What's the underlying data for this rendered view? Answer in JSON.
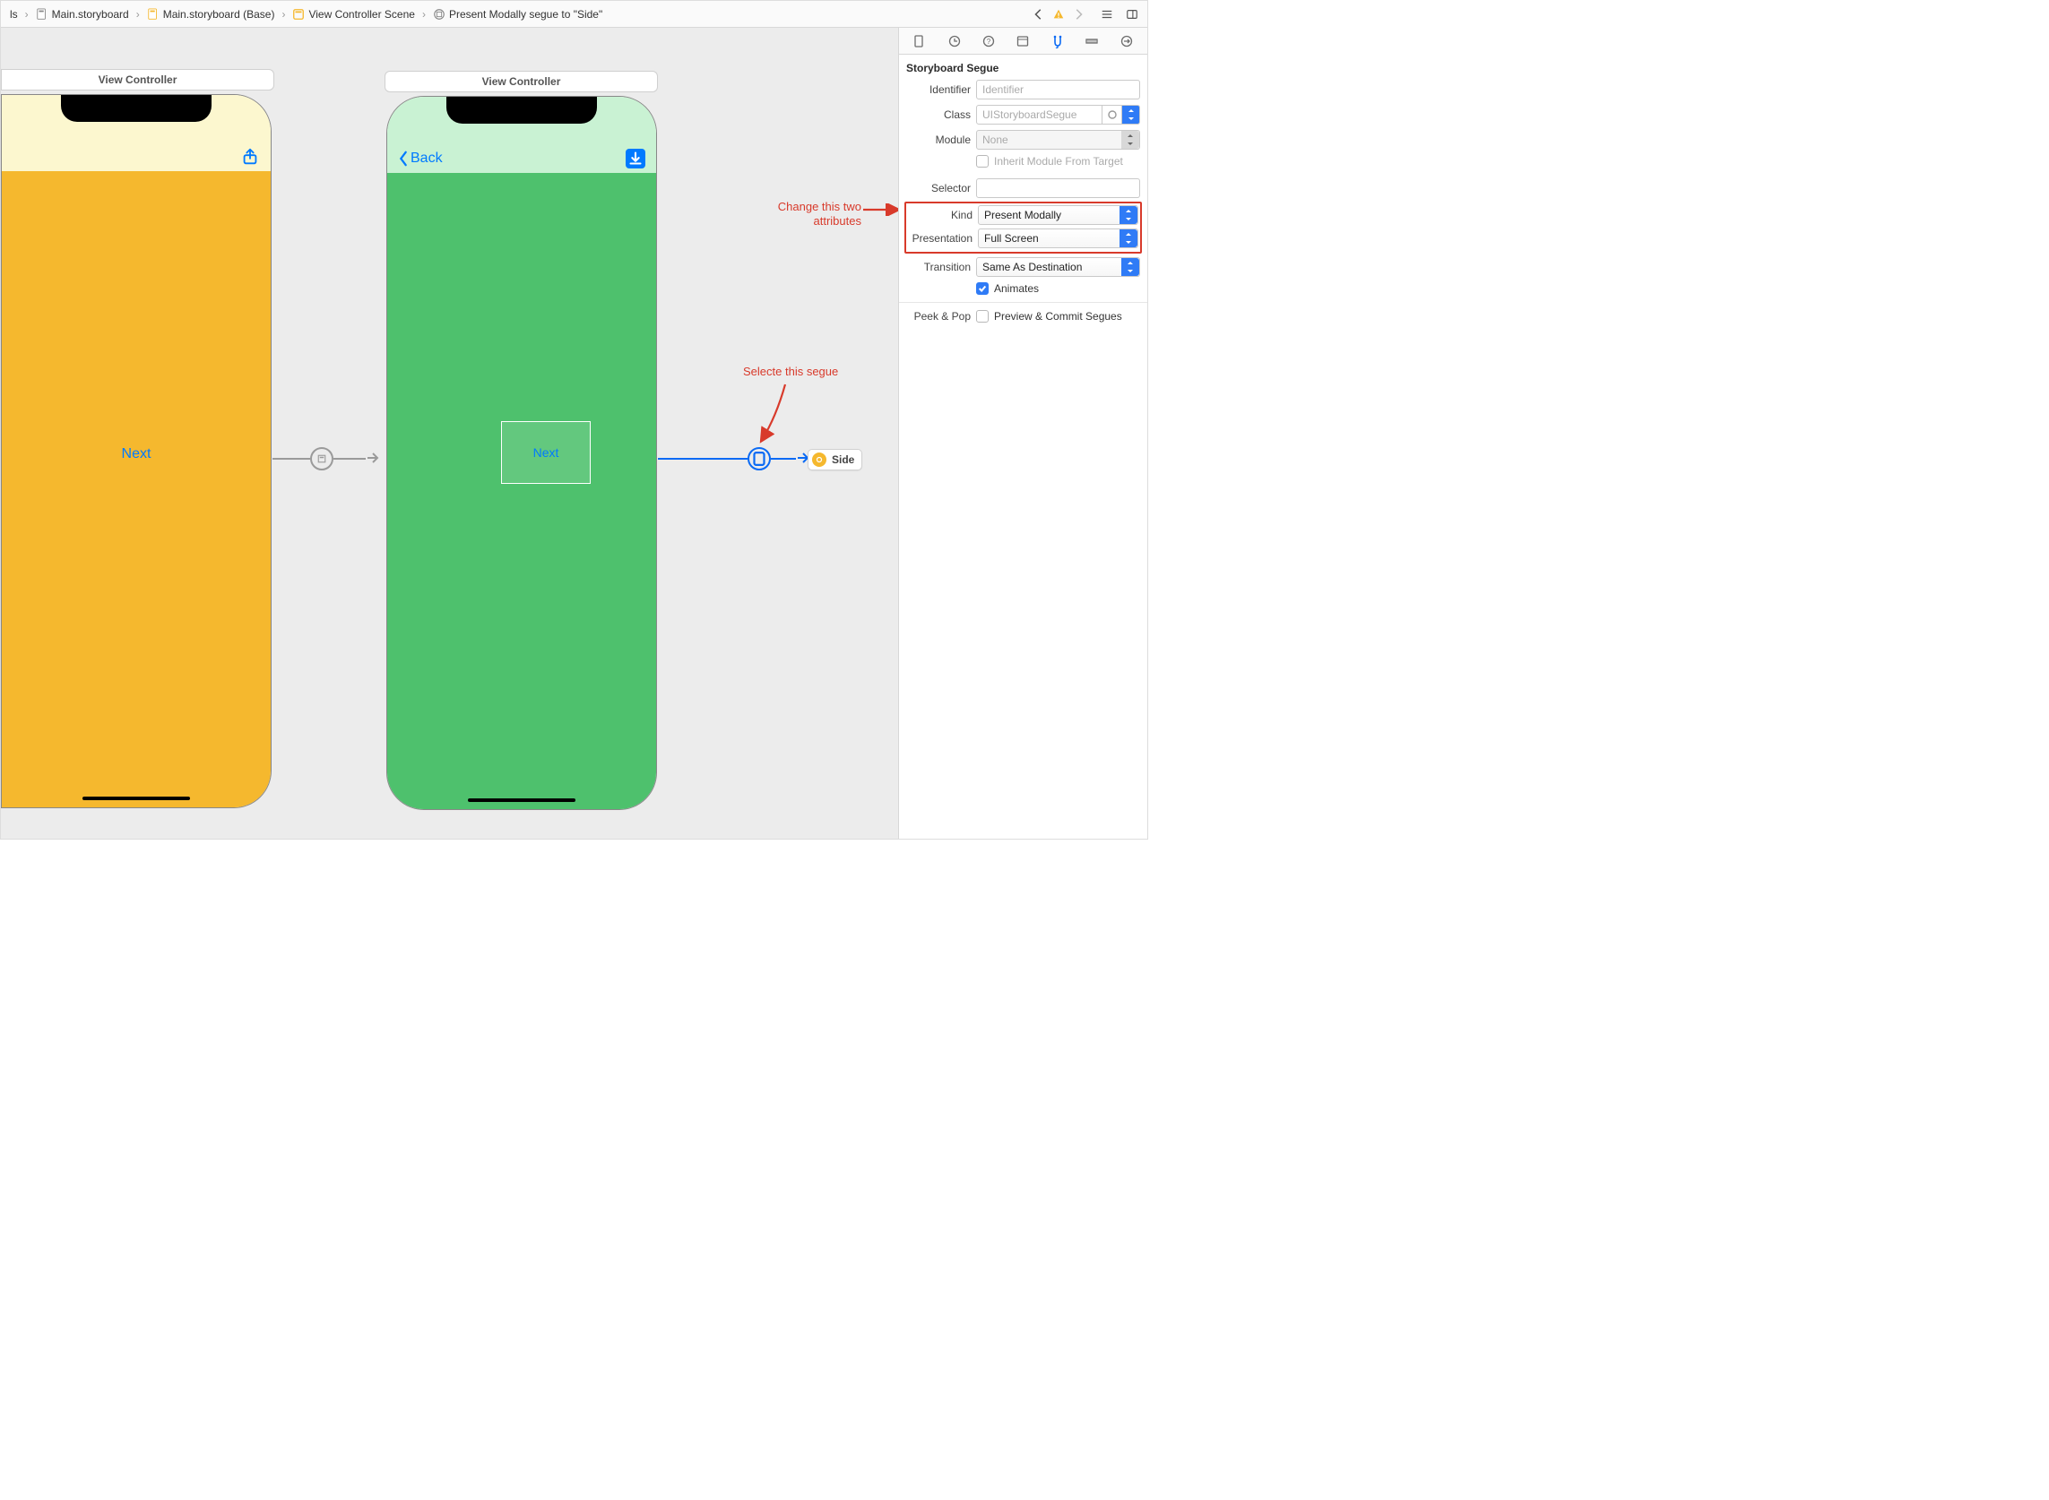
{
  "jumpbar": {
    "crumbs": [
      {
        "label": "ls"
      },
      {
        "label": "Main.storyboard"
      },
      {
        "label": "Main.storyboard (Base)"
      },
      {
        "label": "View Controller Scene"
      },
      {
        "label": "Present Modally segue to \"Side\""
      }
    ]
  },
  "canvas": {
    "vc1": {
      "title": "View Controller",
      "button": "Next"
    },
    "vc2": {
      "title": "View Controller",
      "back_label": "Back",
      "container_button": "Next"
    },
    "side_ref_label": "Side"
  },
  "annotations": {
    "segue": "Selecte this segue",
    "attrs_line1": "Change this two",
    "attrs_line2": "attributes"
  },
  "inspector": {
    "section": "Storyboard Segue",
    "identifier": {
      "label": "Identifier",
      "placeholder": "Identifier",
      "value": ""
    },
    "klass": {
      "label": "Class",
      "placeholder": "UIStoryboardSegue"
    },
    "module": {
      "label": "Module",
      "value": "None"
    },
    "inherit": {
      "label": "Inherit Module From Target",
      "checked": false
    },
    "selector": {
      "label": "Selector",
      "value": ""
    },
    "kind": {
      "label": "Kind",
      "value": "Present Modally"
    },
    "presentation": {
      "label": "Presentation",
      "value": "Full Screen"
    },
    "transition": {
      "label": "Transition",
      "value": "Same As Destination"
    },
    "animates": {
      "label": "Animates",
      "checked": true
    },
    "peekpop": {
      "group": "Peek & Pop",
      "label": "Preview & Commit Segues",
      "checked": false
    }
  }
}
